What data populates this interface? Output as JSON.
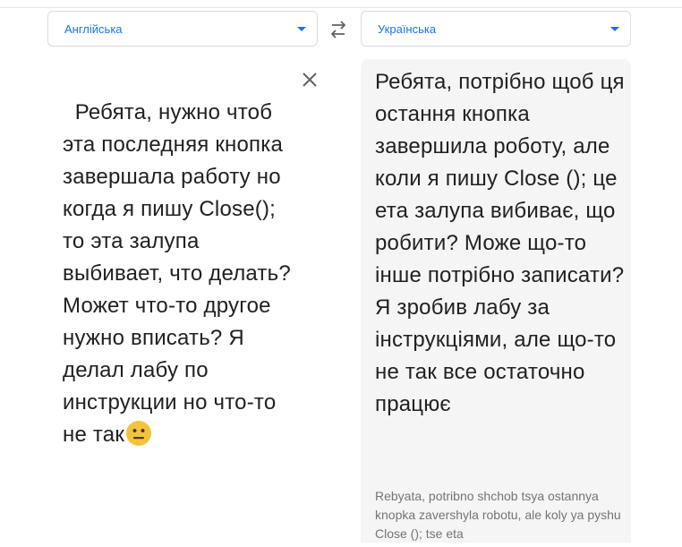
{
  "source": {
    "language": "Англійська",
    "text": "Ребята, нужно чтоб эта последняя кнопка завершала работу но когда я пишу Close(); то эта залупа выбивает, что делать? Может что-то другое нужно вписать? Я делал лабу по инструкции но что-то не так",
    "emoji": "neutral-face-emoji"
  },
  "target": {
    "language": "Українська",
    "text": "Ребята, потрібно щоб ця остання кнопка завершила роботу, але коли я пишу Close (); це ета залупа вибиває, що робити? Може що-то інше потрібно записати? Я зробив лабу за інструкціями, але що-то не так все остаточно працює",
    "transliteration": "Rebyata, potribno shchob tsya ostannya knopka zavershyla robotu, ale koly ya pyshu Close (); tse eta"
  },
  "icons": {
    "swap": "swap-languages-icon",
    "clear": "clear-icon",
    "caret": "chevron-down-icon"
  },
  "colors": {
    "accent": "#1a73e8",
    "text": "#202124",
    "muted": "#70757a",
    "panel": "#f5f5f5"
  }
}
